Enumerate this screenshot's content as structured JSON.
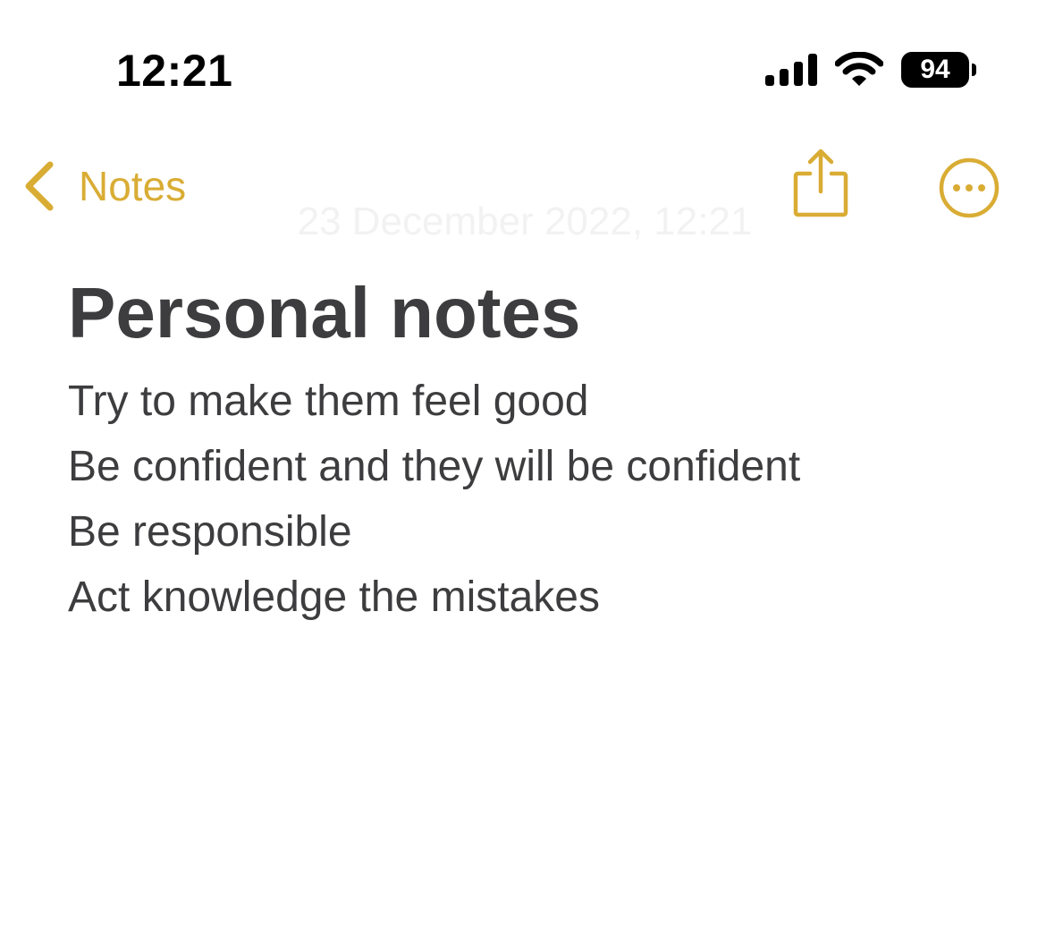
{
  "status_bar": {
    "time": "12:21",
    "battery_level": "94",
    "icons": [
      "signal-icon",
      "wifi-icon",
      "battery-icon"
    ]
  },
  "nav": {
    "back_label": "Notes",
    "back_icon": "chevron-left-icon",
    "share_icon": "share-icon",
    "more_icon": "ellipsis-circle-icon"
  },
  "note": {
    "date": "23 December 2022, 12:21",
    "title": "Personal notes",
    "lines": [
      "Try to make them feel good",
      "Be confident and they will be confident",
      "Be responsible",
      "Act knowledge the mistakes"
    ]
  },
  "colors": {
    "accent": "#d9ac34",
    "text": "#3d3d3f",
    "background": "#ffffff"
  }
}
